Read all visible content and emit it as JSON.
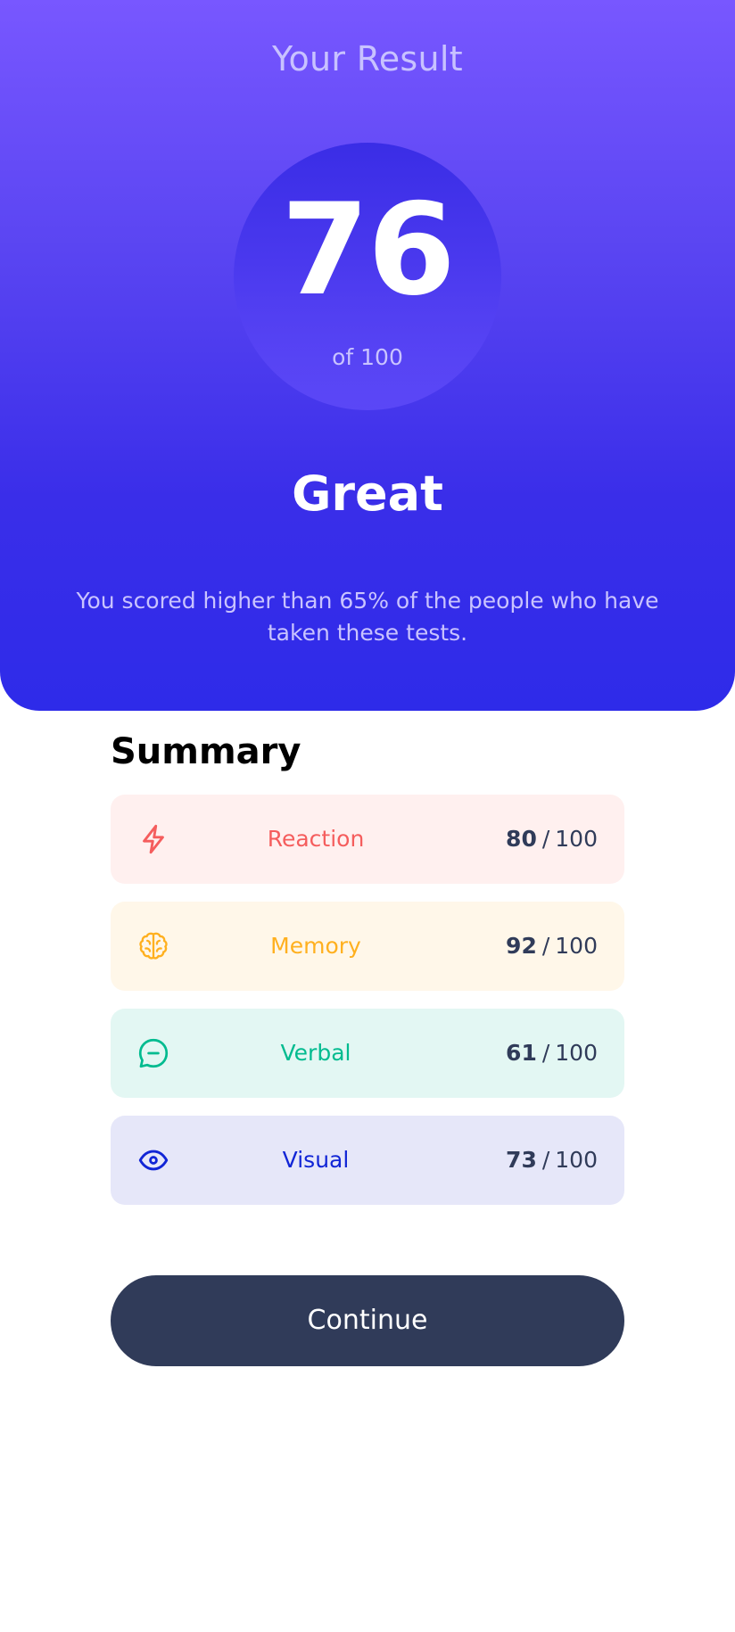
{
  "result": {
    "title": "Your Result",
    "score": "76",
    "score_max_text": "of 100",
    "grade": "Great",
    "description": "You scored higher than 65% of the people who have taken these tests."
  },
  "summary": {
    "title": "Summary",
    "items": [
      {
        "label": "Reaction",
        "icon": "lightning-icon",
        "score": "80",
        "separator": "/",
        "max": "100",
        "accent": "#f55d5d",
        "background": "#fff0ef"
      },
      {
        "label": "Memory",
        "icon": "brain-icon",
        "score": "92",
        "separator": "/",
        "max": "100",
        "accent": "#ffb01f",
        "background": "#fff7e9"
      },
      {
        "label": "Verbal",
        "icon": "chat-icon",
        "score": "61",
        "separator": "/",
        "max": "100",
        "accent": "#00bb8f",
        "background": "#e3f7f3"
      },
      {
        "label": "Visual",
        "icon": "eye-icon",
        "score": "73",
        "separator": "/",
        "max": "100",
        "accent": "#1125d6",
        "background": "#e6e7f9"
      }
    ]
  },
  "actions": {
    "continue_label": "Continue"
  },
  "colors": {
    "gradient_top": "#7857ff",
    "gradient_bottom": "#2e2be9",
    "button_bg": "#303b59"
  }
}
